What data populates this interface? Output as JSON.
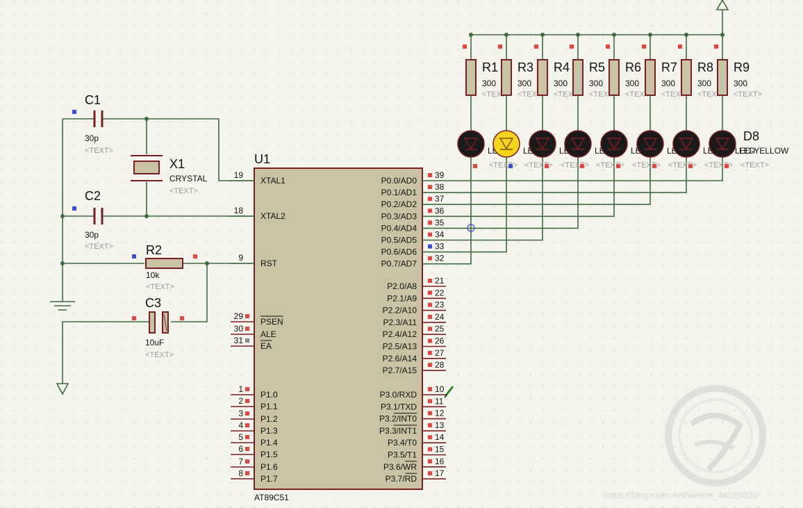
{
  "colors": {
    "background": "#f4f3ec",
    "grid_dot": "#b9b9b1",
    "wire": "#3c6e3c",
    "component_outline": "#7a1f1f",
    "component_fill": "#c9c2a5",
    "chip_fill": "#c9c2a5",
    "pin_marker_red": "#e8453c",
    "pin_marker_blue": "#3a50d9",
    "led_off": "#1a1a1a",
    "led_on": "#f4d31e",
    "watermark_text": "#1fb24b"
  },
  "components": {
    "C1": {
      "ref": "C1",
      "value": "30p",
      "text": "<TEXT>"
    },
    "C2": {
      "ref": "C2",
      "value": "30p",
      "text": "<TEXT>"
    },
    "C3": {
      "ref": "C3",
      "value": "10uF",
      "text": "<TEXT>"
    },
    "X1": {
      "ref": "X1",
      "value": "CRYSTAL",
      "text": "<TEXT>"
    },
    "R2": {
      "ref": "R2",
      "value": "10k",
      "text": "<TEXT>"
    },
    "U1": {
      "ref": "U1",
      "part": "AT89C51"
    },
    "resistor_value": "300",
    "resistor_text": "<TEXT>",
    "resistors": [
      "R1",
      "R2",
      "R3",
      "R4",
      "R5",
      "R6",
      "R7",
      "R8",
      "R9"
    ],
    "led_last_ref": "D8",
    "led_text_fragment": "LED-YELLOW",
    "led_text_placeholder": "<TEXT>"
  },
  "pins_left": [
    {
      "num": "19",
      "name": "XTAL1"
    },
    {
      "num": "18",
      "name": "XTAL2"
    },
    {
      "num": "9",
      "name": "RST"
    },
    {
      "num": "29",
      "name": "PSEN"
    },
    {
      "num": "30",
      "name": "ALE"
    },
    {
      "num": "31",
      "name": "EA"
    },
    {
      "num": "1",
      "name": "P1.0"
    },
    {
      "num": "2",
      "name": "P1.1"
    },
    {
      "num": "3",
      "name": "P1.2"
    },
    {
      "num": "4",
      "name": "P1.3"
    },
    {
      "num": "5",
      "name": "P1.4"
    },
    {
      "num": "6",
      "name": "P1.5"
    },
    {
      "num": "7",
      "name": "P1.6"
    },
    {
      "num": "8",
      "name": "P1.7"
    }
  ],
  "pins_right": [
    {
      "num": "39",
      "name": "P0.0/AD0"
    },
    {
      "num": "38",
      "name": "P0.1/AD1"
    },
    {
      "num": "37",
      "name": "P0.2/AD2"
    },
    {
      "num": "36",
      "name": "P0.3/AD3"
    },
    {
      "num": "35",
      "name": "P0.4/AD4"
    },
    {
      "num": "34",
      "name": "P0.5/AD5"
    },
    {
      "num": "33",
      "name": "P0.6/AD6"
    },
    {
      "num": "32",
      "name": "P0.7/AD7"
    },
    {
      "num": "21",
      "name": "P2.0/A8"
    },
    {
      "num": "22",
      "name": "P2.1/A9"
    },
    {
      "num": "23",
      "name": "P2.2/A10"
    },
    {
      "num": "24",
      "name": "P2.3/A11"
    },
    {
      "num": "25",
      "name": "P2.4/A12"
    },
    {
      "num": "26",
      "name": "P2.5/A13"
    },
    {
      "num": "27",
      "name": "P2.6/A14"
    },
    {
      "num": "28",
      "name": "P2.7/A15"
    },
    {
      "num": "10",
      "name": "P3.0/RXD"
    },
    {
      "num": "11",
      "name": "P3.1/TXD"
    },
    {
      "num": "12",
      "name": "P3.2/INT0"
    },
    {
      "num": "13",
      "name": "P3.3/INT1"
    },
    {
      "num": "14",
      "name": "P3.4/T0"
    },
    {
      "num": "15",
      "name": "P3.5/T1"
    },
    {
      "num": "16",
      "name": "P3.6/WR"
    },
    {
      "num": "17",
      "name": "P3.7/RD"
    }
  ],
  "leds": {
    "lit_index": 1,
    "count": 8
  },
  "watermark": {
    "url": "https://blog.csdn.net/weixin_44026026"
  }
}
